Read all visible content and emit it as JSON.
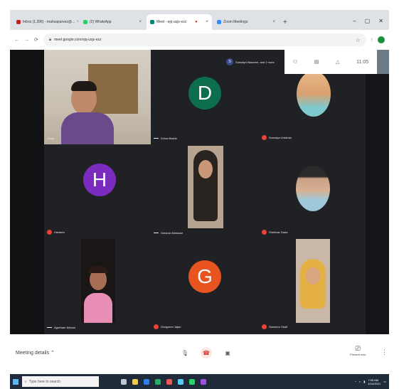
{
  "browser": {
    "tabs": [
      {
        "title": "Inbox (1,396) - mahsaparvez@...",
        "fav": "#c5221f"
      },
      {
        "title": "(2) WhatsApp",
        "fav": "#25d366"
      },
      {
        "title": "Meet - ejq-usjs-ezz",
        "fav": "#00897b",
        "active": true
      },
      {
        "title": "Zoom Meetings",
        "fav": "#2d8cff"
      }
    ],
    "url": "meet.google.com/ejq-usjs-ezz"
  },
  "meet": {
    "presenter_banner": "Sumaiya Waseem, and 2 more",
    "presenter_initial": "S",
    "clock": "11:05",
    "participants": [
      {
        "name": "Vinay",
        "kind": "camera",
        "muted": false
      },
      {
        "name": "Zohra Bashir",
        "kind": "avatar",
        "initial": "D",
        "color": "#0d6e4f",
        "muted": false
      },
      {
        "name": "Sumaiya Urdahan",
        "kind": "camera",
        "muted": true
      },
      {
        "name": "Harsiem",
        "kind": "avatar",
        "initial": "H",
        "color": "#7b2cbf",
        "muted": true
      },
      {
        "name": "Gulshan Bahadar",
        "kind": "camera",
        "muted": false
      },
      {
        "name": "Shehbaz Dada",
        "kind": "camera",
        "muted": true
      },
      {
        "name": "Agrehaer Mohad",
        "kind": "camera",
        "muted": false
      },
      {
        "name": "Gudgreen Jajan",
        "kind": "avatar",
        "initial": "G",
        "color": "#e8541f",
        "muted": true
      },
      {
        "name": "Sanserm Shafi",
        "kind": "camera",
        "muted": true
      }
    ],
    "controls": {
      "meeting_details": "Meeting details",
      "present_now": "Present now"
    }
  },
  "taskbar": {
    "search_placeholder": "Type here to search",
    "time": "7:05 AM",
    "date": "4/10/2021"
  }
}
